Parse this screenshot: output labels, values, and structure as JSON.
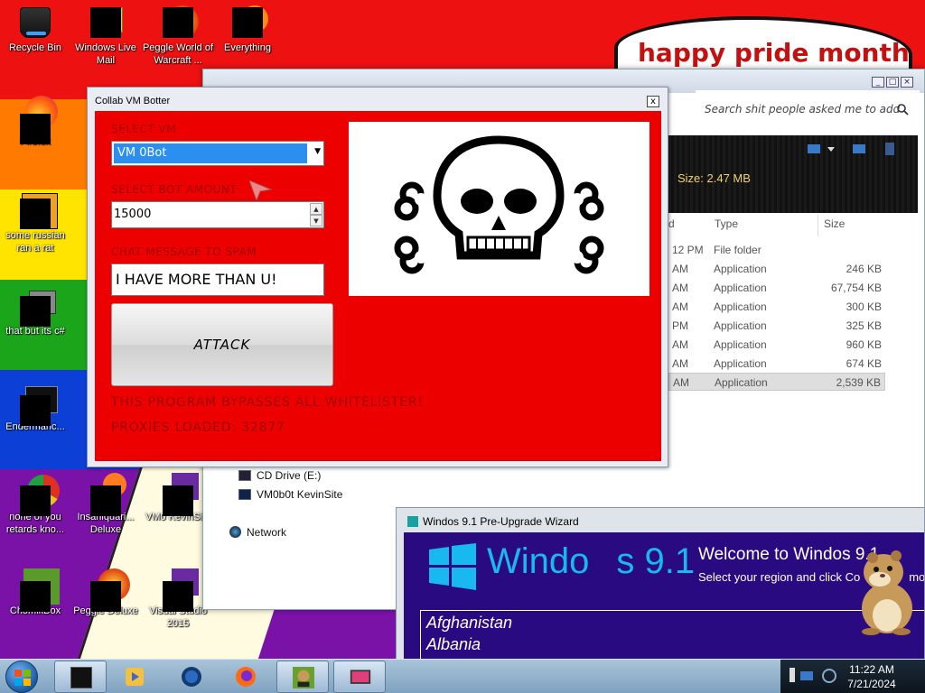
{
  "desktop": {
    "pride_text": "happy pride month",
    "icons": [
      {
        "label": "Recycle Bin"
      },
      {
        "label": "Windows Live Mail"
      },
      {
        "label": "Peggle World of Warcraft ..."
      },
      {
        "label": "Everything"
      },
      {
        "label": "Firefox"
      },
      {
        "label": "some russian ran a rat"
      },
      {
        "label": "that but its c#"
      },
      {
        "label": "Endermanc..."
      },
      {
        "label": "none of you retards kno..."
      },
      {
        "label": "Insaniquari... Deluxe"
      },
      {
        "label": "VM0 KevinSi..."
      },
      {
        "label": "ChomikBox"
      },
      {
        "label": "Peggle Deluxe"
      },
      {
        "label": "Visual Studio 2015"
      }
    ]
  },
  "explorer": {
    "search_placeholder": "Search shit people asked me to add",
    "size_info": "Size: 2.47 MB",
    "columns": {
      "date": "d",
      "type": "Type",
      "size": "Size"
    },
    "rows": [
      {
        "date": "12 PM",
        "type": "File folder",
        "size": ""
      },
      {
        "date": "AM",
        "type": "Application",
        "size": "246 KB"
      },
      {
        "date": "AM",
        "type": "Application",
        "size": "67,754 KB"
      },
      {
        "date": "AM",
        "type": "Application",
        "size": "300 KB"
      },
      {
        "date": "PM",
        "type": "Application",
        "size": "325 KB"
      },
      {
        "date": "AM",
        "type": "Application",
        "size": "960 KB"
      },
      {
        "date": "AM",
        "type": "Application",
        "size": "674 KB"
      },
      {
        "date": "AM",
        "type": "Application",
        "size": "2,539 KB"
      }
    ],
    "nav": {
      "cd_drive": "CD Drive (E:)",
      "kevinsite": "VM0b0t KevinSite",
      "network": "Network"
    }
  },
  "botter": {
    "title": "Collab VM Botter",
    "close": "x",
    "select_vm_label": "SELECT VM",
    "select_vm_value": "VM 0Bot",
    "bot_amount_label": "SELECT BOT AMOUNT",
    "bot_amount_value": "15000",
    "chat_label": "CHAT MESSAGE TO SPAM",
    "chat_value": "I HAVE MORE THAN U!",
    "attack_label": "ATTACK",
    "warning_text": "THIS PROGRAM BYPASSES ALL WHITELISTER!",
    "proxies_text": "PROXIES LOADED: 32877"
  },
  "wizard": {
    "title": "Windos 9.1 Pre-Upgrade Wizard",
    "logo_word": "Windo",
    "logo_version": "s 9.1",
    "welcome": "Welcome to Windos 9.1",
    "region_prompt": "Select your region and click Co",
    "region_prompt_tail": "mov",
    "countries": [
      "Afghanistan",
      "Albania"
    ]
  },
  "taskbar": {
    "time": "11:22 AM",
    "date": "7/21/2024"
  },
  "colors": {
    "botter_red": "#ed0000",
    "label_red": "#a00000",
    "selection_blue": "#2b8ff0",
    "wizard_purple": "#2a0a80",
    "windows_cyan": "#18b8f0"
  }
}
